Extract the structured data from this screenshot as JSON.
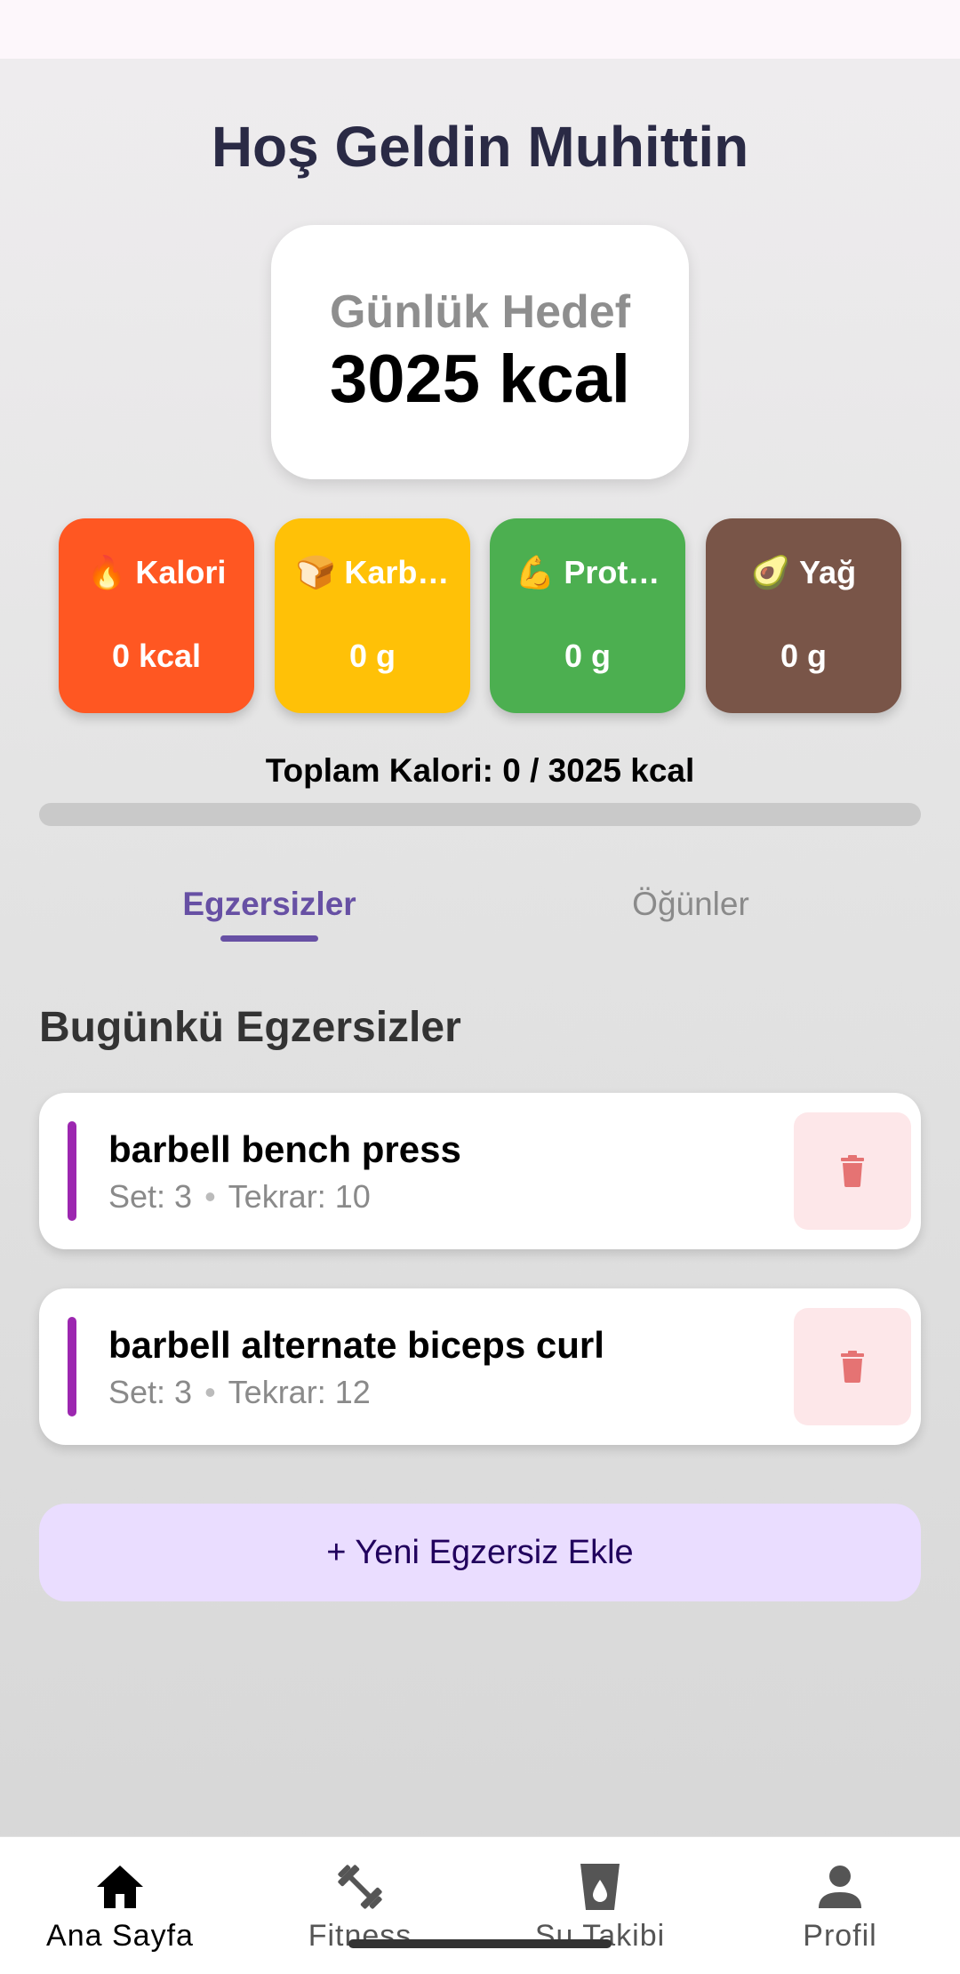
{
  "header": {
    "title": "Hoş Geldin Muhittin"
  },
  "goal": {
    "label": "Günlük Hedef",
    "value": "3025 kcal"
  },
  "macros": [
    {
      "label": "🔥 Kalori",
      "value": "0 kcal",
      "color": "#ff5722"
    },
    {
      "label": "🍞 Karb…",
      "value": "0 g",
      "color": "#ffc107"
    },
    {
      "label": "💪 Prot…",
      "value": "0 g",
      "color": "#4caf50"
    },
    {
      "label": "🥑 Yağ",
      "value": "0 g",
      "color": "#795548"
    }
  ],
  "total": {
    "text": "Toplam Kalori: 0 / 3025 kcal",
    "progress": 0
  },
  "tabs": [
    {
      "label": "Egzersizler",
      "selected": true
    },
    {
      "label": "Öğünler",
      "selected": false
    }
  ],
  "section": {
    "title": "Bugünkü Egzersizler"
  },
  "exercises": [
    {
      "name": "barbell bench press",
      "set": "Set: 3",
      "reps": "Tekrar: 10"
    },
    {
      "name": "barbell alternate biceps curl",
      "set": "Set: 3",
      "reps": "Tekrar: 12"
    }
  ],
  "add_button": {
    "label": "+ Yeni Egzersiz Ekle"
  },
  "bottom_nav": [
    {
      "label": "Ana Sayfa",
      "icon": "home-icon",
      "active": true
    },
    {
      "label": "Fitness",
      "icon": "dumbbell-icon",
      "active": false
    },
    {
      "label": "Su Takibi",
      "icon": "water-glass-icon",
      "active": false
    },
    {
      "label": "Profil",
      "icon": "person-icon",
      "active": false
    }
  ],
  "colors": {
    "accent": "#6750a4",
    "exercise_marker": "#9c27b0",
    "delete": "#e57373"
  }
}
